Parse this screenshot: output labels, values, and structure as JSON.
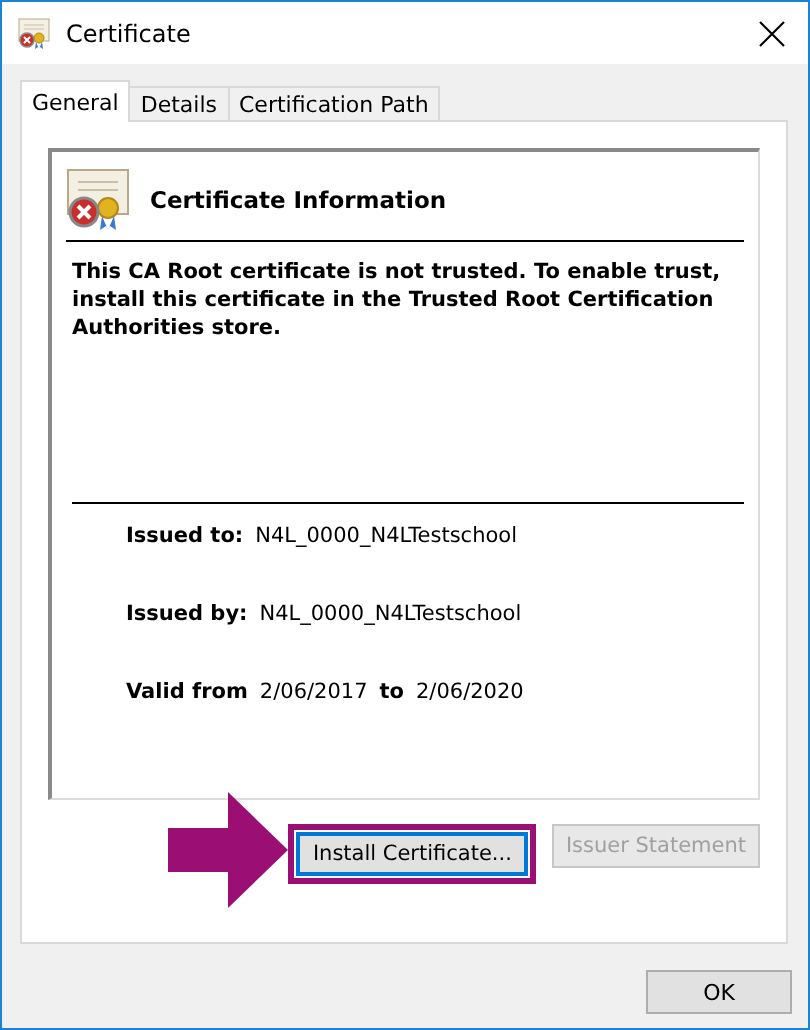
{
  "window": {
    "title": "Certificate"
  },
  "tabs": [
    {
      "label": "General",
      "selected": true
    },
    {
      "label": "Details",
      "selected": false
    },
    {
      "label": "Certification Path",
      "selected": false
    }
  ],
  "info": {
    "heading": "Certificate Information",
    "message": "This CA Root certificate is not trusted. To enable trust, install this certificate in the Trusted Root Certification Authorities store."
  },
  "fields": [
    {
      "label": "Issued to:",
      "value": "N4L_0000_N4LTestschool"
    },
    {
      "label": "Issued by:",
      "value": "N4L_0000_N4LTestschool"
    }
  ],
  "validity": {
    "label": "Valid from",
    "from": "2/06/2017",
    "joiner": "to",
    "to": "2/06/2020"
  },
  "buttons": [
    {
      "label": "Install Certificate...",
      "disabled": false,
      "highlighted": true
    },
    {
      "label": "Issuer Statement",
      "disabled": true,
      "highlighted": false
    }
  ],
  "footer_button": "OK"
}
